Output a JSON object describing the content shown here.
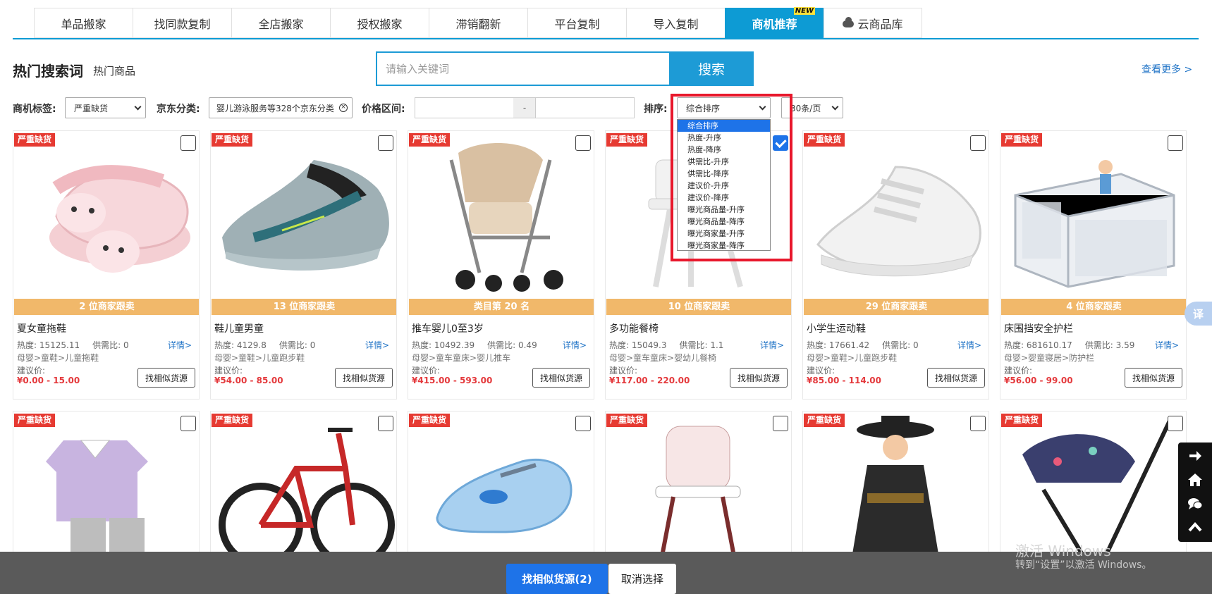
{
  "tabs": [
    {
      "label": "单品搬家"
    },
    {
      "label": "找同款复制"
    },
    {
      "label": "全店搬家"
    },
    {
      "label": "授权搬家"
    },
    {
      "label": "滞销翻新"
    },
    {
      "label": "平台复制"
    },
    {
      "label": "导入复制"
    },
    {
      "label": "商机推荐",
      "badge": "NEW"
    },
    {
      "label": "云商品库",
      "icon": "cloud-icon"
    }
  ],
  "hot": {
    "title": "热门搜索词",
    "subtitle": "热门商品",
    "search_placeholder": "请输入关键词",
    "search_button": "搜索",
    "see_more": "查看更多 >"
  },
  "filters": {
    "tag_label": "商机标签:",
    "tag_value": "严重缺货",
    "jd_label": "京东分类:",
    "jd_value": "婴儿游泳服务等328个京东分类",
    "price_label": "价格区间:",
    "price_dash": "-",
    "sort_label": "排序:",
    "sort_value": "综合排序",
    "page_size": "30条/页"
  },
  "sort_options": [
    "综合排序",
    "热度-升序",
    "热度-降序",
    "供需比-升序",
    "供需比-降序",
    "建议价-升序",
    "建议价-降序",
    "曝光商品量-升序",
    "曝光商品量-降序",
    "曝光商家量-升序",
    "曝光商家量-降序"
  ],
  "products_row1": [
    {
      "badge": "严重缺货",
      "bar": "2 位商家跟卖",
      "name": "夏女童拖鞋",
      "heat": "热度: 15125.11",
      "ratio": "供需比: 0",
      "detail": "详情>",
      "category": "母婴>童鞋>儿童拖鞋",
      "price_label": "建议价:",
      "price": "¥0.00 - 15.00",
      "find": "找相似货源",
      "checked": false
    },
    {
      "badge": "严重缺货",
      "bar": "13 位商家跟卖",
      "name": "鞋儿童男童",
      "heat": "热度: 4129.8",
      "ratio": "供需比: 0",
      "detail": "详情>",
      "category": "母婴>童鞋>儿童跑步鞋",
      "price_label": "建议价:",
      "price": "¥54.00 - 85.00",
      "find": "找相似货源",
      "checked": false
    },
    {
      "badge": "严重缺货",
      "bar": "类目第 20 名",
      "name": "推车婴儿0至3岁",
      "heat": "热度: 10492.39",
      "ratio": "供需比: 0.49",
      "detail": "详情>",
      "category": "母婴>童车童床>婴儿推车",
      "price_label": "建议价:",
      "price": "¥415.00 - 593.00",
      "find": "找相似货源",
      "checked": false
    },
    {
      "badge": "严重缺货",
      "bar": "10 位商家跟卖",
      "name": "多功能餐椅",
      "heat": "热度: 15049.3",
      "ratio": "供需比: 1.1",
      "detail": "详情>",
      "category": "母婴>童车童床>婴幼儿餐椅",
      "price_label": "建议价:",
      "price": "¥117.00 - 220.00",
      "find": "找相似货源",
      "checked": true
    },
    {
      "badge": "严重缺货",
      "bar": "29 位商家跟卖",
      "name": "小学生运动鞋",
      "heat": "热度: 17661.42",
      "ratio": "供需比: 0",
      "detail": "详情>",
      "category": "母婴>童鞋>儿童跑步鞋",
      "price_label": "建议价:",
      "price": "¥85.00 - 114.00",
      "find": "找相似货源",
      "checked": false
    },
    {
      "badge": "严重缺货",
      "bar": "4 位商家跟卖",
      "name": "床围挡安全护栏",
      "heat": "热度: 681610.17",
      "ratio": "供需比: 3.59",
      "detail": "详情>",
      "category": "母婴>婴童寝居>防护栏",
      "price_label": "建议价:",
      "price": "¥56.00 - 99.00",
      "find": "找相似货源",
      "checked": false
    }
  ],
  "products_row2": [
    {
      "badge": "严重缺货"
    },
    {
      "badge": "严重缺货"
    },
    {
      "badge": "严重缺货"
    },
    {
      "badge": "严重缺货"
    },
    {
      "badge": "严重缺货"
    },
    {
      "badge": "严重缺货"
    }
  ],
  "bottom": {
    "primary": "找相似货源(2)",
    "cancel": "取消选择"
  },
  "watermark": {
    "line1": "激活 Windows",
    "line2": "转到“设置”以激活 Windows。"
  },
  "translate_label": "译",
  "colors": {
    "accent": "#0d9bd4",
    "badge_red": "#e63a32",
    "bar_orange": "#f1b86a",
    "price_red": "#e4393c",
    "primary_blue": "#1e73e8",
    "highlight_box": "#e8182c"
  }
}
